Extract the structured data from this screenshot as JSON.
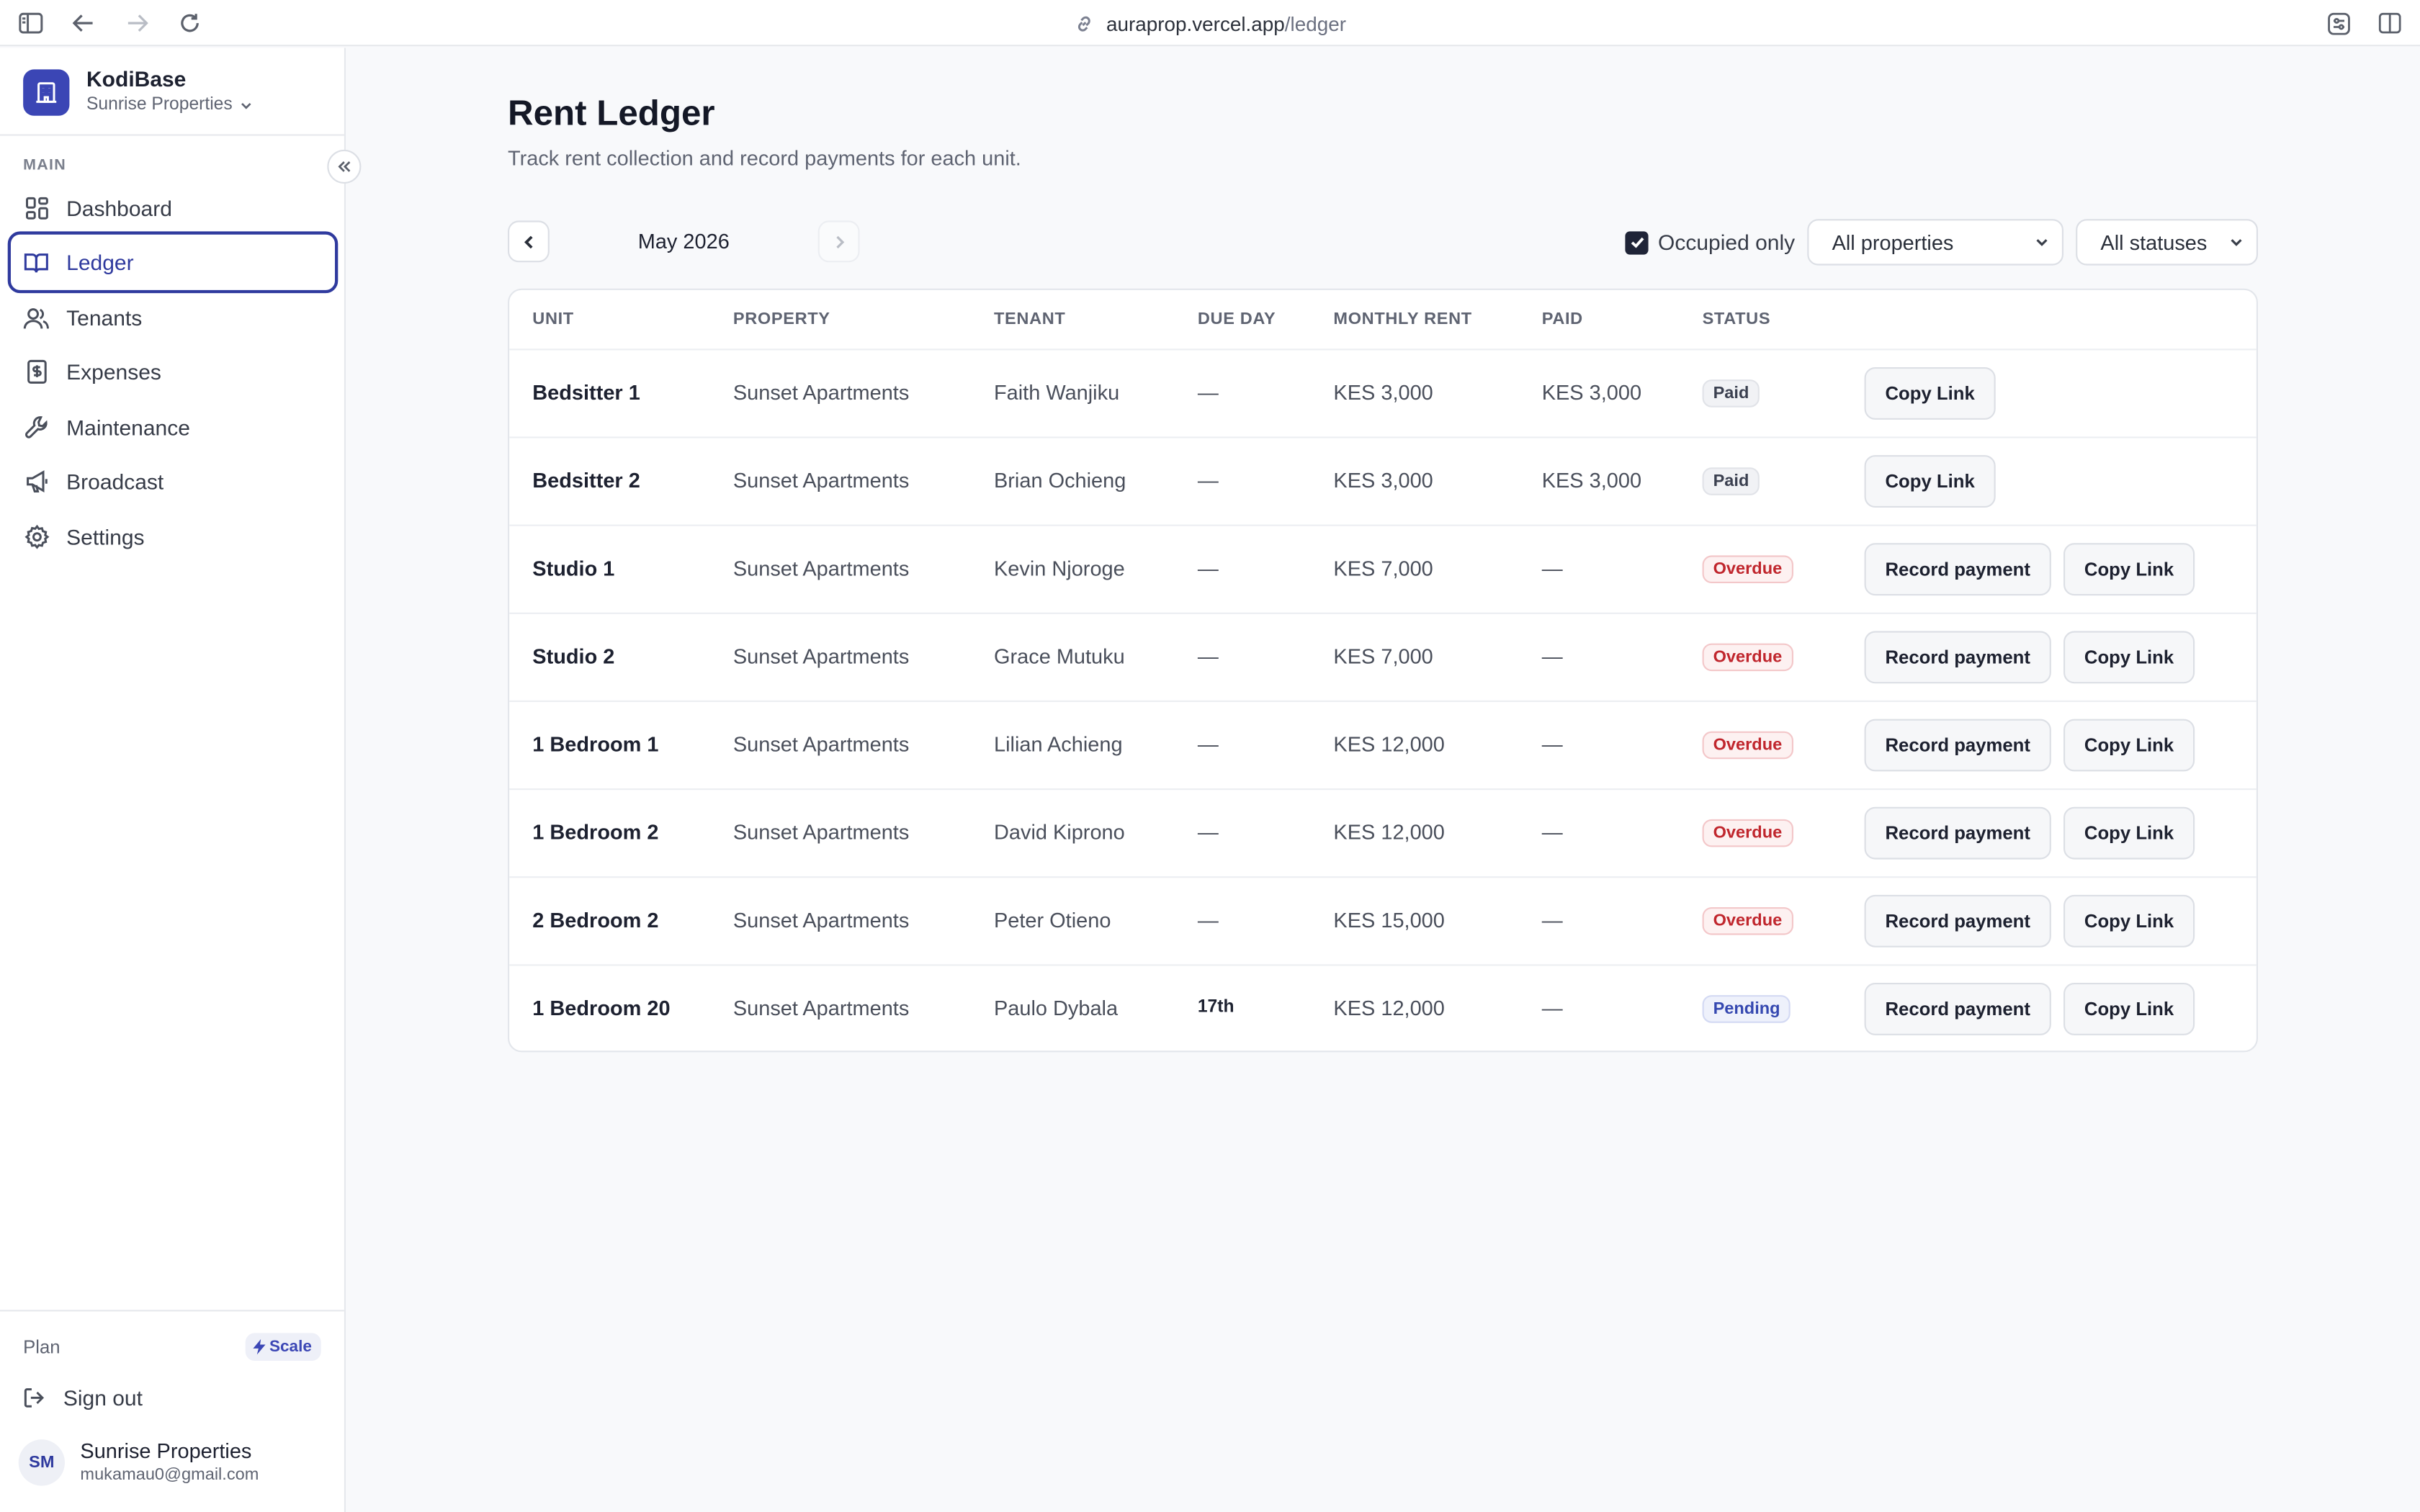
{
  "browser": {
    "url_host": "auraprop.vercel.app",
    "url_path": "/ledger"
  },
  "brand": {
    "name": "KodiBase",
    "org": "Sunrise Properties"
  },
  "sidebar": {
    "section_label": "MAIN",
    "items": [
      {
        "label": "Dashboard",
        "icon": "dashboard-icon"
      },
      {
        "label": "Ledger",
        "icon": "book-icon",
        "active": true
      },
      {
        "label": "Tenants",
        "icon": "users-icon"
      },
      {
        "label": "Expenses",
        "icon": "receipt-icon"
      },
      {
        "label": "Maintenance",
        "icon": "wrench-icon"
      },
      {
        "label": "Broadcast",
        "icon": "megaphone-icon"
      },
      {
        "label": "Settings",
        "icon": "gear-icon"
      }
    ],
    "plan_label": "Plan",
    "plan_badge": "Scale",
    "signout_label": "Sign out",
    "user": {
      "initials": "SM",
      "name": "Sunrise Properties",
      "email": "mukamau0@gmail.com"
    }
  },
  "page": {
    "title": "Rent Ledger",
    "subtitle": "Track rent collection and record payments for each unit."
  },
  "toolbar": {
    "month": "May 2026",
    "occupied_only_label": "Occupied only",
    "occupied_only_checked": true,
    "property_filter": "All properties",
    "status_filter": "All statuses"
  },
  "table": {
    "headers": [
      "UNIT",
      "PROPERTY",
      "TENANT",
      "DUE DAY",
      "MONTHLY RENT",
      "PAID",
      "STATUS"
    ],
    "record_label": "Record payment",
    "copy_label": "Copy Link",
    "rows": [
      {
        "unit": "Bedsitter 1",
        "property": "Sunset Apartments",
        "tenant": "Faith Wanjiku",
        "due": "—",
        "rent": "KES 3,000",
        "paid": "KES 3,000",
        "status": "Paid"
      },
      {
        "unit": "Bedsitter 2",
        "property": "Sunset Apartments",
        "tenant": "Brian Ochieng",
        "due": "—",
        "rent": "KES 3,000",
        "paid": "KES 3,000",
        "status": "Paid"
      },
      {
        "unit": "Studio 1",
        "property": "Sunset Apartments",
        "tenant": "Kevin Njoroge",
        "due": "—",
        "rent": "KES 7,000",
        "paid": "—",
        "status": "Overdue"
      },
      {
        "unit": "Studio 2",
        "property": "Sunset Apartments",
        "tenant": "Grace Mutuku",
        "due": "—",
        "rent": "KES 7,000",
        "paid": "—",
        "status": "Overdue"
      },
      {
        "unit": "1 Bedroom 1",
        "property": "Sunset Apartments",
        "tenant": "Lilian Achieng",
        "due": "—",
        "rent": "KES 12,000",
        "paid": "—",
        "status": "Overdue"
      },
      {
        "unit": "1 Bedroom 2",
        "property": "Sunset Apartments",
        "tenant": "David Kiprono",
        "due": "—",
        "rent": "KES 12,000",
        "paid": "—",
        "status": "Overdue"
      },
      {
        "unit": "2 Bedroom 2",
        "property": "Sunset Apartments",
        "tenant": "Peter Otieno",
        "due": "—",
        "rent": "KES 15,000",
        "paid": "—",
        "status": "Overdue"
      },
      {
        "unit": "1 Bedroom 20",
        "property": "Sunset Apartments",
        "tenant": "Paulo Dybala",
        "due": "17th",
        "rent": "KES 12,000",
        "paid": "—",
        "status": "Pending"
      }
    ]
  },
  "colors": {
    "accent": "#2f3a9e",
    "brand_logo": "#3b46b5",
    "overdue": "#c0262d",
    "pending": "#3548b0"
  }
}
